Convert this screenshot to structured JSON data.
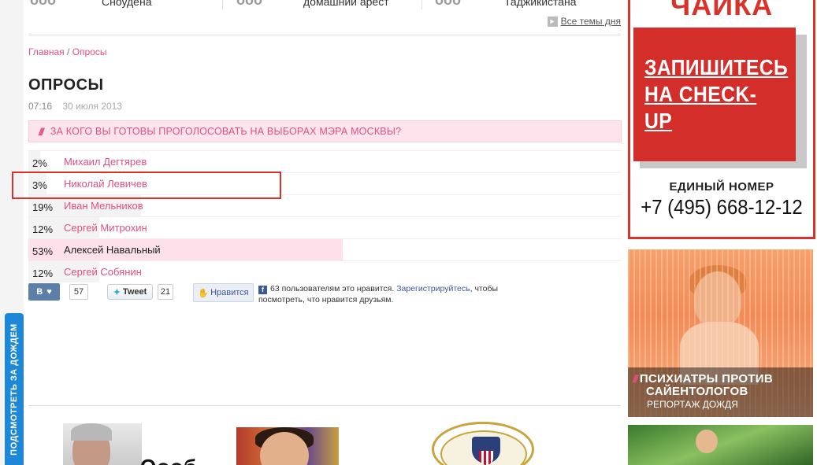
{
  "top_news": [
    {
      "text": "Сноудена"
    },
    {
      "text": "домашний арест"
    },
    {
      "text": "Таджикистана"
    }
  ],
  "all_topics_label": "Все темы дня",
  "breadcrumb": {
    "home": "Главная",
    "separator": "/",
    "current": "Опросы"
  },
  "page_title": "ОПРОСЫ",
  "meta": {
    "time": "07:16",
    "date": "30 июля 2013"
  },
  "question": "ЗА КОГО ВЫ ГОТОВЫ ПРОГОЛОСОВАТЬ НА ВЫБОРАХ МЭРА МОСКВЫ?",
  "poll": {
    "options": [
      {
        "percent_label": "2%",
        "value": 2,
        "name": "Михаил Дегтярев"
      },
      {
        "percent_label": "3%",
        "value": 3,
        "name": "Николай Левичев"
      },
      {
        "percent_label": "19%",
        "value": 19,
        "name": "Иван Мельников"
      },
      {
        "percent_label": "12%",
        "value": 12,
        "name": "Сергей Митрохин"
      },
      {
        "percent_label": "53%",
        "value": 53,
        "name": "Алексей Навальный"
      },
      {
        "percent_label": "12%",
        "value": 12,
        "name": "Сергей Собянин"
      }
    ],
    "leader_index": 4,
    "highlighted_index": 1,
    "accent_color": "#e0507e",
    "leader_bar_color": "#fde0ea",
    "highlight_border_color": "#d9322b"
  },
  "social": {
    "vk_label": "В",
    "vk_count": "57",
    "tweet_label": "Tweet",
    "tweet_count": "21",
    "fb_like_label": "Нравится",
    "fb_text_before": "63 пользователям это нравится.",
    "fb_register_link": "Зарегистрируйтесь",
    "fb_text_after": ", чтобы посмотреть, что нравится друзьям."
  },
  "side_tab_label": "ПОДСМОТРЕТЬ ЗА ДОЖДЕМ",
  "bottom_thumbs": [
    {
      "caption": "Оооб"
    }
  ],
  "right_ads": {
    "ad1": {
      "brand": "ЧАЙКА",
      "cta_line1": "ЗАПИШИТЕСЬ",
      "cta_line2": "НА CHECK-UP",
      "label": "ЕДИНЫЙ НОМЕР",
      "phone": "+7 (495) 668-12-12"
    },
    "ad2": {
      "title_line1": "ПСИХИАТРЫ ПРОТИВ",
      "title_line2": "САЙЕНТОЛОГОВ",
      "subtitle": "РЕПОРТАЖ ДОЖДЯ"
    }
  },
  "colors": {
    "accent_pink": "#e0507e",
    "side_tab_blue": "#1e88d6",
    "ad_red": "#d42e2a"
  }
}
